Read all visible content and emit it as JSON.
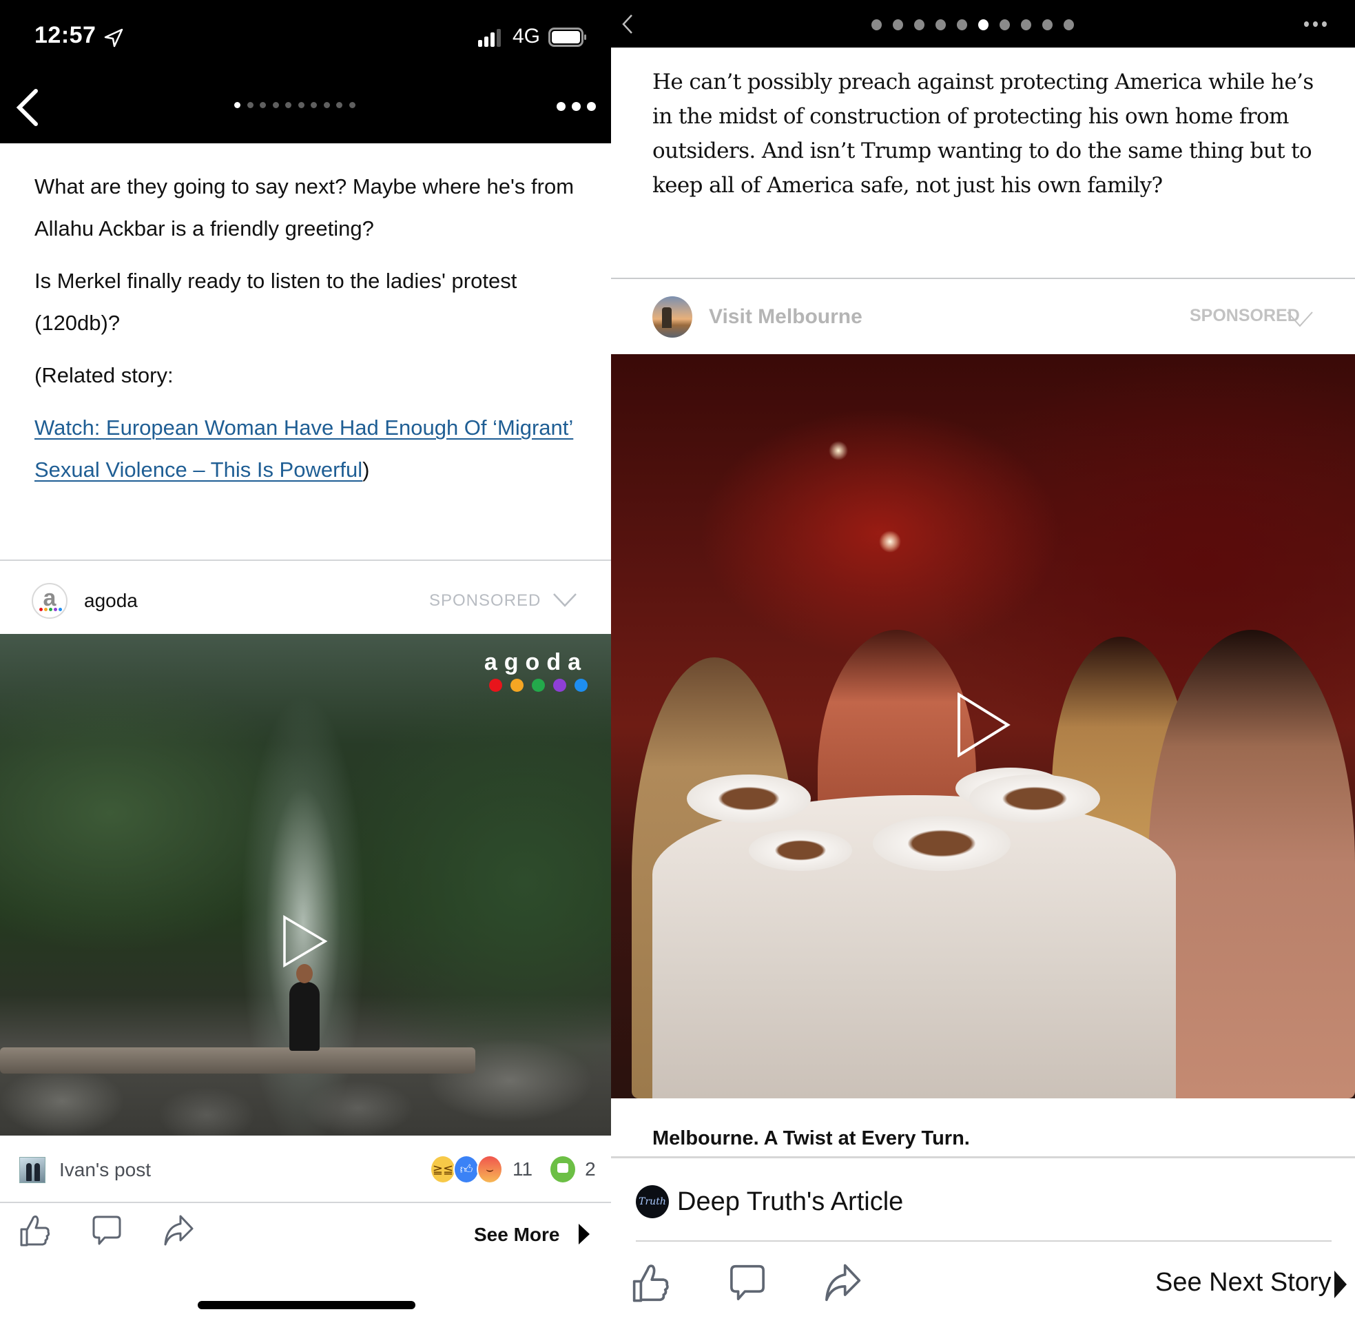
{
  "left": {
    "status_bar": {
      "time": "12:57",
      "location_icon": "location-arrow-icon",
      "signal_icon": "cellular-signal-icon",
      "network": "4G",
      "battery_icon": "battery-icon"
    },
    "nav": {
      "back_icon": "chevron-left-icon",
      "page_dots": {
        "total": 10,
        "active_index": 0
      },
      "more_icon": "more-horizontal-icon"
    },
    "article": {
      "paragraphs": [
        "What are they going to say next? Maybe where he's from Allahu Ackbar is a friendly greeting?",
        "Is Merkel finally ready to listen to the ladies' protest (120db)?",
        "(Related story:"
      ],
      "link_text": "Watch: European Woman Have Had Enough Of ‘Migrant’ Sexual Violence – This Is Powerful",
      "link_suffix": ")"
    },
    "ad": {
      "advertiser": "agoda",
      "avatar_letter": "a",
      "sponsored_label": "SPONSORED",
      "chevron_icon": "chevron-down-icon",
      "media": {
        "brand_word": "agoda",
        "brand_dot_colors": [
          "#e8141b",
          "#f5a623",
          "#23a94b",
          "#8e3fd6",
          "#1e8ef0"
        ],
        "play_icon": "play-icon"
      }
    },
    "footer": {
      "post_label": "Ivan's post",
      "reactions": [
        "haha",
        "like",
        "angry"
      ],
      "reaction_count": "11",
      "comment_count": "2"
    },
    "actions": {
      "like_icon": "thumbs-up-icon",
      "comment_icon": "comment-icon",
      "share_icon": "share-icon",
      "see_more_label": "See More"
    }
  },
  "right": {
    "nav": {
      "back_icon": "chevron-left-icon",
      "page_dots": {
        "total": 10,
        "active_index": 5
      },
      "more_icon": "more-horizontal-icon"
    },
    "article": {
      "text": "He can’t possibly preach against protecting America while he’s in the midst of construction of protecting his own home from outsiders. And isn’t Trump wanting to do the same thing but to keep all of America safe, not just his own family?"
    },
    "ad": {
      "advertiser": "Visit Melbourne",
      "sponsored_label": "SPONSORED",
      "chevron_icon": "chevron-down-icon",
      "play_icon": "play-icon",
      "caption": "Melbourne. A Twist at Every Turn."
    },
    "source": {
      "avatar_text": "Truth",
      "label": "Deep Truth's Article"
    },
    "actions": {
      "like_icon": "thumbs-up-icon",
      "comment_icon": "comment-icon",
      "share_icon": "share-icon",
      "see_next_label": "See Next Story"
    }
  },
  "colors": {
    "link": "#1f5e94",
    "sponsored_gray": "#b8bcc2",
    "action_icon_gray": "#5f6672",
    "reaction_like": "#3b82f6",
    "comment_green": "#6cbf45"
  }
}
